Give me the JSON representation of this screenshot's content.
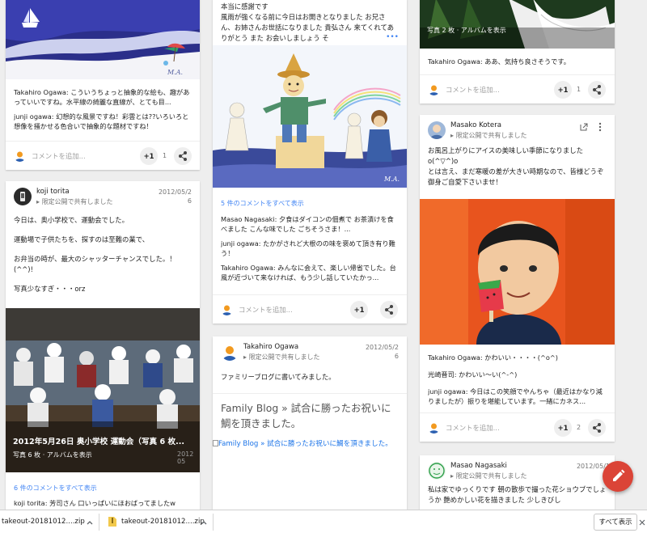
{
  "cards": {
    "watercolor": {
      "comment1_author": "Takahiro Ogawa:",
      "comment1_text": " こういうちょっと抽象的な絵も、趣があっていいですね。水平線の綺麗な直線が、とても目...",
      "comment2_author": "junji ogawa:",
      "comment2_text": " 幻想的な風景ですね！彩雲とは??いろいろと想像を掻かせる色合いで抽象的な題材ですね！",
      "add_comment": "コメントを追加...",
      "plus": "+1",
      "plus_count": "1"
    },
    "koji": {
      "name": "koji torita",
      "shared": "限定公開で共有しました",
      "date": "2012/05/2",
      "date2": "6",
      "lines": [
        "今日は、奥小学校で、運動会でした。",
        "運動場で子供たちを、探すのは至難の業で、",
        "お弁当の時が、最大のシャッターチャンスでした。！(^^)!",
        "写真少なすぎ・・・orz"
      ],
      "album_title": "2012年5月26日 奥小学校 運動会（写真 6 枚...",
      "album_sub": "写真 6 枚 · アルバムを表示",
      "album_date": "2012 05",
      "view_all": "6 件のコメントをすべて表示",
      "comment_author": "koji torita:",
      "comment_text": " 芳司さん 口いっぱいにほおばってましたw"
    },
    "scarecrow": {
      "line1": "本当に感謝です",
      "body": "風雨が強くなる前に今日はお開きとなりました お兄さん、お姉さんお世話になりました 貴弘さん 来てくれてありがとう また お会いしましょう そ",
      "more": "•••",
      "view_all": "5 件のコメントをすべて表示",
      "c1_author": "Masao Nagasaki:",
      "c1_text": " 夕食はダイコンの佃煮で お茶漬けを食べました こんな味でした ごちそうさま！...",
      "c2_author": "junji ogawa:",
      "c2_text": " たかがされど大根のの味を褒めて頂き有り難う！",
      "c3_author": "Takahiro Ogawa:",
      "c3_text": " みんなに会えて、楽しい帰省でした。台風が近づいて来なければ、もう少し話していたかっ...",
      "add_comment": "コメントを追加...",
      "plus": "+1"
    },
    "familyblog": {
      "name": "Takahiro Ogawa",
      "shared": "限定公開で共有しました",
      "date": "2012/05/2",
      "date2": "6",
      "text": "ファミリーブログに書いてみました。",
      "link_title": "Family Blog » 試合に勝ったお祝いに鯛を頂きました。",
      "link_img": "Family Blog » 試合に勝ったお祝いに鯛を頂きました。"
    },
    "flower": {
      "album_sub": "写真 2 枚 · アルバムを表示",
      "comment_author": "Takahiro Ogawa:",
      "comment_text": " ああ、気持ち良さそうです。",
      "add_comment": "コメントを追加...",
      "plus": "+1",
      "plus_count": "1"
    },
    "masako": {
      "name": "Masako Kotera",
      "shared": "限定公開で共有しました",
      "lines": [
        "お風呂上がりにアイスの美味しい季節になりました",
        "o(^▽^)o",
        "とは言え、まだ寒暖の差が大きい時期なので、皆様どうぞ御身ご自愛下さいませ！"
      ],
      "c1_author": "Takahiro Ogawa:",
      "c1_text": " かわいい・・・・(^o^)",
      "c2_author": "光崎晋司:",
      "c2_text": " かわいい〜い(^-^)",
      "c3_author": "junji ogawa:",
      "c3_text": " 今日はこの笑顔でやんちゃ（最近はかなり減りましたが）振りを堪能しています。一緒にカネス...",
      "add_comment": "コメントを追加...",
      "plus": "+1",
      "plus_count": "2"
    },
    "masao": {
      "name": "Masao Nagasaki",
      "shared": "限定公開で共有しました",
      "date": "2012/05/1",
      "lines": [
        "私は家でゆっくりです 朝の散歩で撮った花ショウブでしょうか 艶めかしい花を描きました 少しきびし"
      ]
    }
  },
  "downloads": {
    "file1": "takeout-20181012....zip",
    "file2": "takeout-20181012....zip",
    "show_all": "すべて表示"
  }
}
